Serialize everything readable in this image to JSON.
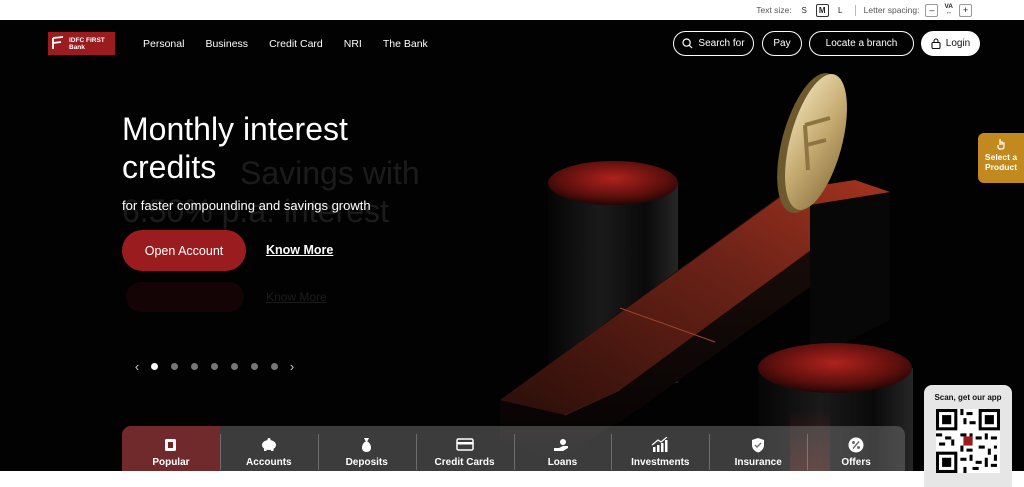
{
  "accessibility": {
    "text_size_label": "Text size:",
    "sizes": [
      "S",
      "M",
      "L"
    ],
    "active_size": "M",
    "letter_spacing_label": "Letter spacing:",
    "decrease": "–",
    "spacing_icon_text": "VA",
    "increase": "+"
  },
  "header": {
    "logo_line1": "IDFC FIRST",
    "logo_line2": "Bank",
    "nav": [
      "Personal",
      "Business",
      "Credit Card",
      "NRI",
      "The Bank"
    ],
    "search_label": "Search for",
    "pay_label": "Pay",
    "locate_label": "Locate a branch",
    "login_label": "Login"
  },
  "hero": {
    "title": "Monthly interest credits",
    "subtitle": "for faster compounding and savings growth",
    "primary_cta": "Open Account",
    "secondary_cta": "Know More",
    "ghost_line1": "Savings with",
    "ghost_line2": "6.50% p.a. interest",
    "ghost_cta": "Know More"
  },
  "carousel": {
    "slide_count": 7,
    "active_index": 0
  },
  "select_product": {
    "line1": "Select a",
    "line2": "Product"
  },
  "qr": {
    "caption": "Scan, get our app"
  },
  "categories": [
    {
      "label": "Popular",
      "icon": "popular-icon"
    },
    {
      "label": "Accounts",
      "icon": "piggy-bank-icon"
    },
    {
      "label": "Deposits",
      "icon": "money-bag-icon"
    },
    {
      "label": "Credit Cards",
      "icon": "credit-card-icon"
    },
    {
      "label": "Loans",
      "icon": "hand-coin-icon"
    },
    {
      "label": "Investments",
      "icon": "growth-chart-icon"
    },
    {
      "label": "Insurance",
      "icon": "shield-icon"
    },
    {
      "label": "Offers",
      "icon": "discount-badge-icon"
    }
  ],
  "colors": {
    "brand_red": "#9b1c1f",
    "accent_gold": "#c28a1e",
    "background": "#020202"
  }
}
